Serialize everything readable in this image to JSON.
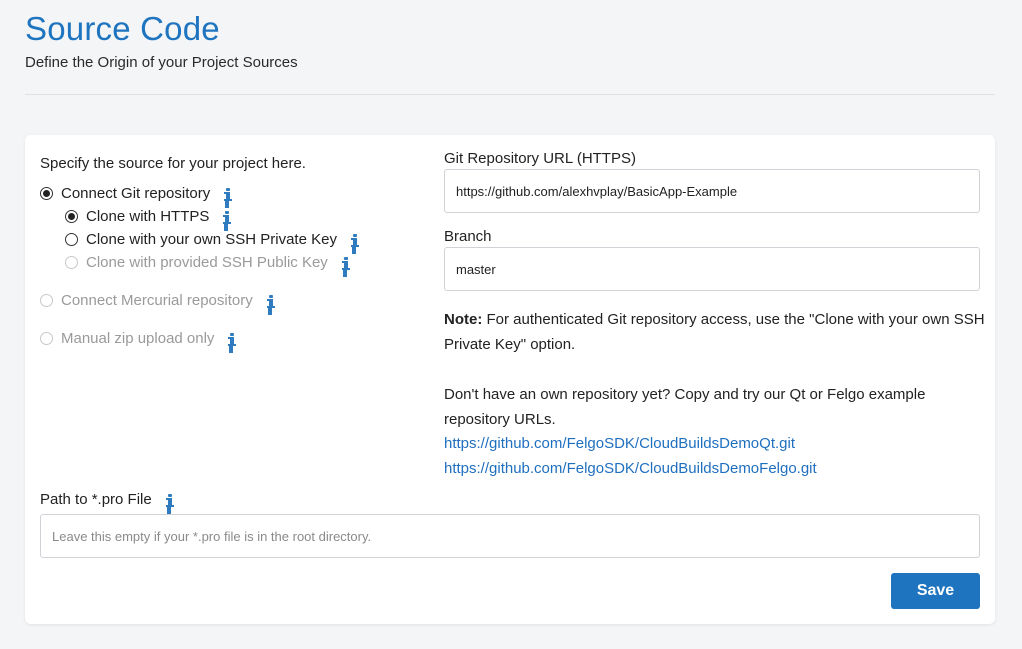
{
  "header": {
    "title": "Source Code",
    "subtitle": "Define the Origin of your Project Sources"
  },
  "source": {
    "intro": "Specify the source for your project here.",
    "options": [
      {
        "label": "Connect Git repository",
        "selected": true,
        "enabled": true
      },
      {
        "label": "Clone with HTTPS",
        "selected": true,
        "enabled": true
      },
      {
        "label": "Clone with your own SSH Private Key",
        "selected": false,
        "enabled": true
      },
      {
        "label": "Clone with provided SSH Public Key",
        "selected": false,
        "enabled": false
      },
      {
        "label": "Connect Mercurial repository",
        "selected": false,
        "enabled": false
      },
      {
        "label": "Manual zip upload only",
        "selected": false,
        "enabled": false
      }
    ]
  },
  "git": {
    "url_label": "Git Repository URL (HTTPS)",
    "url_value": "https://github.com/alexhvplay/BasicApp-Example",
    "branch_label": "Branch",
    "branch_value": "master"
  },
  "note": {
    "prefix": "Note:",
    "text": " For authenticated Git repository access, use the \"Clone with your own SSH Private Key\" option."
  },
  "help": {
    "text": "Don't have an own repository yet? Copy and try our Qt or Felgo example repository URLs.",
    "links": [
      "https://github.com/FelgoSDK/CloudBuildsDemoQt.git",
      "https://github.com/FelgoSDK/CloudBuildsDemoFelgo.git"
    ]
  },
  "pro_file": {
    "label": "Path to *.pro File",
    "placeholder": "Leave this empty if your *.pro file is in the root directory.",
    "value": ""
  },
  "actions": {
    "save_label": "Save"
  },
  "colors": {
    "accent": "#1f74bf",
    "link": "#1f6fbf",
    "info": "#2f7bc0"
  }
}
